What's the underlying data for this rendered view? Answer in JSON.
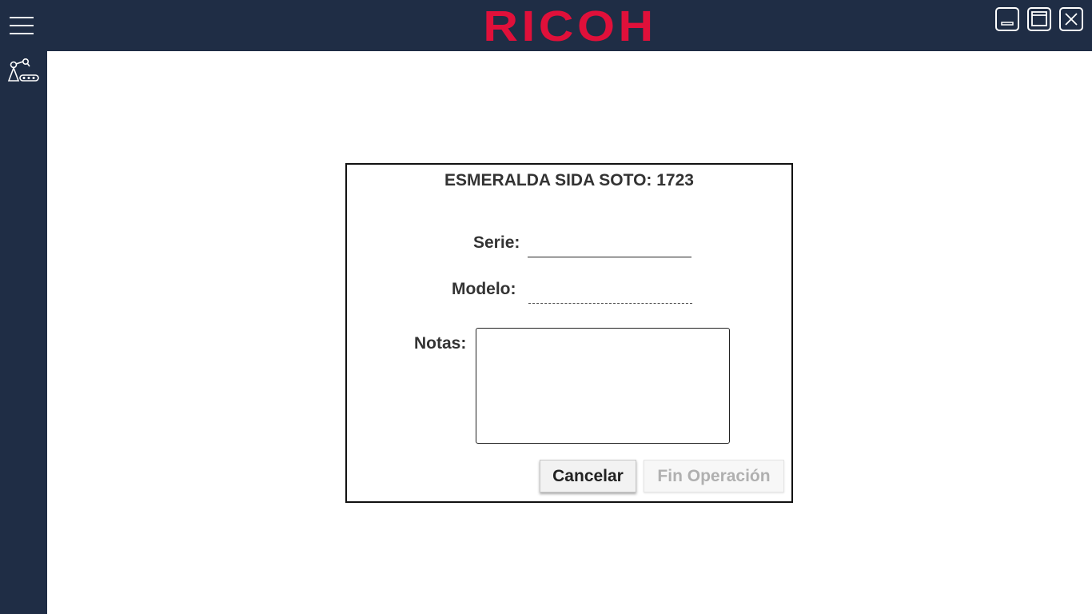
{
  "header": {
    "logo_text": "RICOH",
    "logo_color": "#e0103a",
    "background_color": "#1f2d45",
    "menu_icon": "hamburger-icon",
    "window_controls": [
      "minimize-icon",
      "maximize-icon",
      "close-icon"
    ]
  },
  "sidebar": {
    "items": [
      {
        "icon": "robot-arm-conveyor-icon"
      }
    ]
  },
  "dialog": {
    "title": "ESMERALDA SIDA SOTO: 1723",
    "serie_label": "Serie:",
    "serie_value": "",
    "modelo_label": "Modelo:",
    "modelo_value": "",
    "notas_label": "Notas:",
    "notas_value": "",
    "cancel_label": "Cancelar",
    "finish_label": "Fin Operación"
  }
}
